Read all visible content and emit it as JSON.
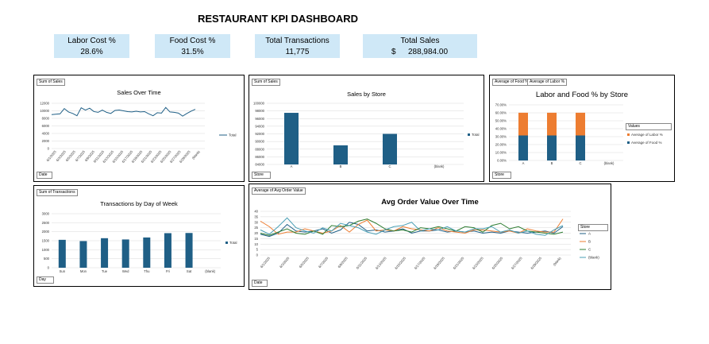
{
  "dashboard": {
    "title": "RESTAURANT KPI DASHBOARD"
  },
  "kpis": [
    {
      "label": "Labor Cost %",
      "value": "28.6%"
    },
    {
      "label": "Food Cost %",
      "value": "31.5%"
    },
    {
      "label": "Total Transactions",
      "value": "11,775"
    },
    {
      "label": "Total Sales",
      "currency": "$",
      "value": "288,984.00"
    }
  ],
  "panels": {
    "sales_over_time": {
      "field": "Sum of Sales",
      "axis_field": "Date",
      "legend": "Total"
    },
    "sales_by_store": {
      "field": "Sum of Sales",
      "axis_field": "Store",
      "legend": "Total"
    },
    "labor_food": {
      "field1": "Average of Food %",
      "field2": "Average of Labor %",
      "axis_field": "Store",
      "legend_title": "Values"
    },
    "transactions_dow": {
      "field": "Sum of Transactions",
      "axis_field": "Day",
      "legend": "Total"
    },
    "aov": {
      "field": "Average of Avg Order Value",
      "axis_field": "Date",
      "legend_title": "Store"
    }
  },
  "colors": {
    "primary": "#1f5f86",
    "orange": "#ed7d31",
    "green": "#2e7d32",
    "teal": "#4a9fb5"
  },
  "chart_data": [
    {
      "id": "sales_over_time",
      "type": "line",
      "title": "Sales Over Time",
      "xlabel": "",
      "ylabel": "",
      "ylim": [
        0,
        12000
      ],
      "yticks": [
        "0",
        "2000",
        "4000",
        "6000",
        "8000",
        "10000",
        "12000"
      ],
      "x": [
        "6/1/2025",
        "6/3/2025",
        "6/5/2025",
        "6/7/2025",
        "6/9/2025",
        "6/11/2025",
        "6/13/2025",
        "6/15/2025",
        "6/17/2025",
        "6/19/2025",
        "6/21/2025",
        "6/23/2025",
        "6/25/2025",
        "6/27/2025",
        "6/29/2025",
        "(blank)"
      ],
      "series": [
        {
          "name": "Total",
          "values": [
            9000,
            9100,
            9200,
            10600,
            9700,
            9300,
            8700,
            10800,
            10200,
            10700,
            9800,
            9600,
            10200,
            9600,
            9300,
            10100,
            10200,
            10000,
            9800,
            9700,
            9900,
            9700,
            9800,
            9200,
            8700,
            9500,
            9400,
            10900,
            9700,
            9600,
            9400,
            8600,
            9300,
            9900,
            10400
          ]
        }
      ]
    },
    {
      "id": "sales_by_store",
      "type": "bar",
      "title": "Sales by Store",
      "ylim": [
        84000,
        100000
      ],
      "yticks": [
        "84000",
        "86000",
        "88000",
        "90000",
        "92000",
        "94000",
        "96000",
        "98000",
        "100000"
      ],
      "categories": [
        "A",
        "B",
        "C",
        "(blank)"
      ],
      "series": [
        {
          "name": "Total",
          "values": [
            97500,
            89000,
            92000,
            null
          ]
        }
      ]
    },
    {
      "id": "labor_food",
      "type": "bar",
      "title": "Labor and Food % by Store",
      "ylim": [
        0,
        0.7
      ],
      "yticks": [
        "0.00%",
        "10.00%",
        "20.00%",
        "30.00%",
        "40.00%",
        "50.00%",
        "60.00%",
        "70.00%"
      ],
      "categories": [
        "A",
        "B",
        "C",
        "(blank)"
      ],
      "stacked": true,
      "series": [
        {
          "name": "Average of Food %",
          "values": [
            0.315,
            0.315,
            0.315,
            null
          ]
        },
        {
          "name": "Average of Labor %",
          "values": [
            0.286,
            0.286,
            0.286,
            null
          ]
        }
      ]
    },
    {
      "id": "transactions_dow",
      "type": "bar",
      "title": "Transactions by Day of Week",
      "ylim": [
        0,
        3000
      ],
      "yticks": [
        "0",
        "500",
        "1000",
        "1500",
        "2000",
        "2500",
        "3000"
      ],
      "categories": [
        "Sun",
        "Mon",
        "Tue",
        "Wed",
        "Thu",
        "Fri",
        "Sat",
        "(blank)"
      ],
      "series": [
        {
          "name": "Total",
          "values": [
            1550,
            1480,
            1640,
            1570,
            1680,
            1920,
            1930,
            null
          ]
        }
      ]
    },
    {
      "id": "aov",
      "type": "line",
      "title": "Avg Order Value Over Time",
      "ylim": [
        0,
        40
      ],
      "yticks": [
        "0",
        "5",
        "10",
        "15",
        "20",
        "25",
        "30",
        "35",
        "40"
      ],
      "x": [
        "6/1/2025",
        "6/3/2025",
        "6/5/2025",
        "6/7/2025",
        "6/9/2025",
        "6/11/2025",
        "6/13/2025",
        "6/15/2025",
        "6/17/2025",
        "6/19/2025",
        "6/21/2025",
        "6/23/2025",
        "6/25/2025",
        "6/27/2025",
        "6/29/2025",
        "(blank)"
      ],
      "series": [
        {
          "name": "A",
          "values": [
            19,
            17,
            20,
            28,
            22,
            21,
            22,
            24,
            20,
            23,
            30,
            28,
            22,
            23,
            21,
            22,
            24,
            20,
            22,
            22,
            23,
            21,
            22,
            21,
            22,
            20,
            21,
            20,
            22,
            21,
            20,
            21,
            22,
            20,
            26
          ]
        },
        {
          "name": "B",
          "values": [
            31,
            26,
            19,
            21,
            21,
            24,
            22,
            20,
            22,
            27,
            21,
            28,
            32,
            22,
            23,
            22,
            26,
            24,
            23,
            22,
            25,
            22,
            21,
            20,
            23,
            23,
            22,
            21,
            22,
            20,
            24,
            22,
            21,
            21,
            33
          ]
        },
        {
          "name": "C",
          "values": [
            20,
            18,
            21,
            24,
            20,
            19,
            22,
            19,
            27,
            26,
            27,
            31,
            33,
            29,
            24,
            22,
            23,
            21,
            25,
            24,
            26,
            24,
            22,
            26,
            25,
            21,
            27,
            29,
            24,
            26,
            22,
            21,
            20,
            19,
            21
          ]
        },
        {
          "name": "(blank)",
          "values": [
            23,
            19,
            26,
            34,
            25,
            22,
            20,
            25,
            22,
            29,
            27,
            25,
            21,
            19,
            23,
            26,
            27,
            30,
            22,
            24,
            23,
            26,
            22,
            21,
            24,
            24,
            26,
            21,
            23,
            20,
            22,
            19,
            18,
            23,
            27
          ]
        }
      ]
    }
  ]
}
